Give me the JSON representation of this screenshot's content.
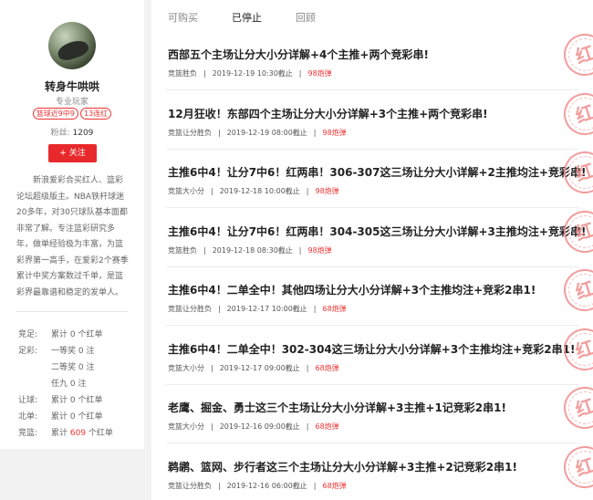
{
  "profile": {
    "name": "转身牛哄哄",
    "title": "专业玩家",
    "tags": [
      "篮球近9中9",
      "13连红"
    ],
    "fans_label": "粉丝:",
    "fans_value": "1209",
    "follow_label": "+ 关注",
    "bio": "新浪爱彩合买红人、篮彩论坛超级版主。NBA铁杆球迷20多年，对30只球队基本面都非常了解。专注篮彩研究多年，做单经验极为丰富，为篮彩界第一高手，在爱彩2个赛季累计中奖方案数过千单，是篮彩界最靠谱和稳定的发单人。"
  },
  "stats": [
    {
      "label": "竞足:",
      "value": "累计 0 个红单"
    },
    {
      "label": "足彩:",
      "value": "一等奖 0 注"
    },
    {
      "label": "",
      "value": "二等奖 0 注"
    },
    {
      "label": "",
      "value": "任九 0 注"
    },
    {
      "label": "让球:",
      "value": "累计 0 个红单"
    },
    {
      "label": "北单:",
      "value": "累计 0 个红单"
    },
    {
      "label": "竞篮:",
      "value": "累计 609 个红单",
      "highlight": true
    }
  ],
  "tabs": [
    "可购买",
    "已停止",
    "回顾"
  ],
  "active_tab": "已停止",
  "stamp_text": "红",
  "articles": [
    {
      "title": "西部五个主场让分大小分详解+4个主推+两个竞彩串!",
      "category": "竞篮胜负",
      "time": "2019-12-19 10:30截止",
      "price": "98炮弹"
    },
    {
      "title": "12月狂收！东部四个主场让分大小分详解+3个主推+两个竞彩串!",
      "category": "竞篮让分胜负",
      "time": "2019-12-19 08:00截止",
      "price": "98炮弹"
    },
    {
      "title": "主推6中4！让分7中6！红两串！306-307这三场让分大小详解+2主推均注+竞彩串!",
      "category": "竞篮大小分",
      "time": "2019-12-18 10:00截止",
      "price": "98炮弹"
    },
    {
      "title": "主推6中4！让分7中6！红两串！304-305这三场让分大小详解+3主推均注+竞彩串!",
      "category": "竞篮胜负",
      "time": "2019-12-18 08:30截止",
      "price": "98炮弹"
    },
    {
      "title": "主推6中4！二单全中！其他四场让分大小分详解+3个主推均注+竞彩2串1!",
      "category": "竞篮让分胜负",
      "time": "2019-12-17 10:00截止",
      "price": "68炮弹"
    },
    {
      "title": "主推6中4！二单全中！302-304这三场让分大小分详解+3个主推均注+竞彩2串1!",
      "category": "竞篮大小分",
      "time": "2019-12-17 09:00截止",
      "price": "68炮弹"
    },
    {
      "title": "老鹰、掘金、勇士这三个主场让分大小分详解+3主推+1记竞彩2串1!",
      "category": "竞篮大小分",
      "time": "2019-12-16 09:00截止",
      "price": "68炮弹"
    },
    {
      "title": "鹈鹕、篮网、步行者这三个主场让分大小分详解+3主推+2记竞彩2串1!",
      "category": "竞篮让分胜负",
      "time": "2019-12-16 06:00截止",
      "price": "68炮弹"
    }
  ]
}
